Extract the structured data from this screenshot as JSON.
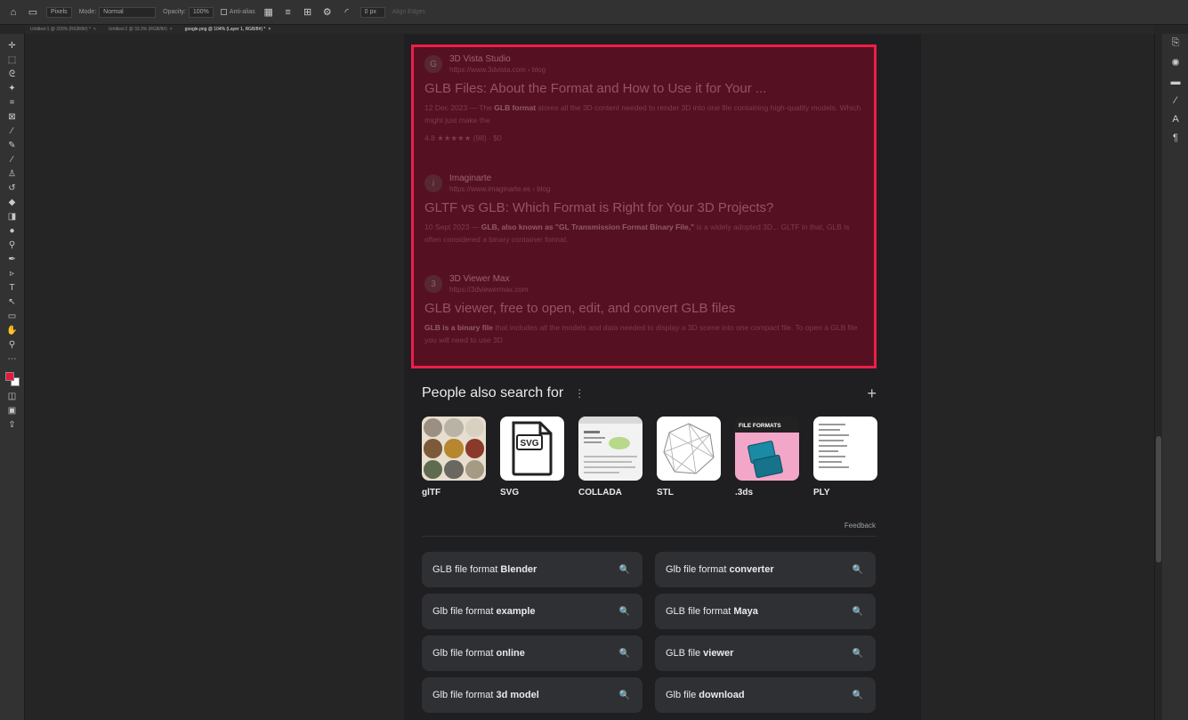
{
  "options_bar": {
    "style_label": "Pixels",
    "mode_label": "Mode:",
    "mode_value": "Normal",
    "opacity_label": "Opacity:",
    "opacity_value": "100%",
    "antialias_label": "Anti-alias",
    "stroke_value": "0 px",
    "align_edges_label": "Align Edges"
  },
  "doc_tabs": [
    {
      "label": "Untitled-1 @ 200% (RGB/8#) *",
      "close": "×"
    },
    {
      "label": "Untitled-2 @ 33.3% (RGB/8#)",
      "close": "×"
    },
    {
      "label": "google.png @ 104% (Layer 1, RGB/8#) *",
      "close": "×"
    }
  ],
  "results": [
    {
      "logo": "G",
      "site": "3D Vista Studio",
      "url": "https://www.3dvista.com › blog",
      "title": "GLB Files: About the Format and How to Use it for Your ...",
      "snippet_pre": "12 Dec 2023 — The ",
      "snippet_bold": "GLB format",
      "snippet_post": " stores all the 3D content needed to render 3D into one file containing high-quality models. Which might just make the",
      "rating": "4.8 ★★★★★ (98) · $0"
    },
    {
      "logo": "i",
      "site": "Imaginarte",
      "url": "https://www.imaginarte.es › blog",
      "title": "GLTF vs GLB: Which Format is Right for Your 3D Projects?",
      "snippet_pre": "10 Sept 2023 — ",
      "snippet_bold": "GLB, also known as \"GL Transmission Format Binary File,\"",
      "snippet_post": " is a widely adopted 3D... GLTF in that, GLB is often considered a binary container format."
    },
    {
      "logo": "3",
      "site": "3D Viewer Max",
      "url": "https://3dviewermax.com",
      "title": "GLB viewer, free to open, edit, and convert GLB files",
      "snippet_pre": "",
      "snippet_bold": "GLB is a binary file",
      "snippet_post": " that includes all the models and data needed to display a 3D scene into one compact file. To open a GLB file you will need to use 3D"
    }
  ],
  "pasf": {
    "title": "People also search for",
    "more_icon": "more-vertical-icon",
    "plus": "+",
    "items": [
      {
        "label": "glTF"
      },
      {
        "label": "SVG",
        "badge": "SVG"
      },
      {
        "label": "COLLADA"
      },
      {
        "label": "STL"
      },
      {
        "label": ".3ds",
        "caption": "FILE FORMATS"
      },
      {
        "label": "PLY"
      }
    ]
  },
  "feedback_label": "Feedback",
  "related": [
    {
      "pre": "GLB file format",
      "bold": "Blender"
    },
    {
      "pre": "Glb file format",
      "bold": "converter"
    },
    {
      "pre": "Glb file format",
      "bold": "example"
    },
    {
      "pre": "GLB file format",
      "bold": "Maya"
    },
    {
      "pre": "Glb file format",
      "bold": "online"
    },
    {
      "pre": "GLB file",
      "bold": "viewer"
    },
    {
      "pre": "Glb file format",
      "bold": "3d model"
    },
    {
      "pre": "Glb file",
      "bold": "download"
    }
  ],
  "colors": {
    "foreground_swatch": "#e8173b",
    "background_swatch": "#ffffff",
    "selection_border": "#ef1d48"
  }
}
